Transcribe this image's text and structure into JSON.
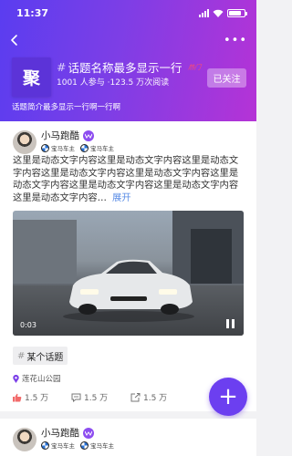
{
  "status_bar": {
    "time": "11:37"
  },
  "topic": {
    "logo_char": "聚",
    "hash": "#",
    "title": "话题名称最多显示一行",
    "hot_label": "热门",
    "stats": "1001 人参与 ·123.5 万次阅读",
    "follow_label": "已关注",
    "description": "话题简介最多显示一行啊一行啊"
  },
  "post": {
    "username": "小马跑酷",
    "badges": [
      "宝马车主",
      "宝马车主"
    ],
    "content": "这里是动态文字内容这里是动态文字内容这里是动态文字内容这里是动态文字内容这里是动态文字内容这里是动态文字内容这里是动态文字内容这里是动态文字内容这里是动态文字内容…",
    "expand_label": "展开",
    "video_time": "0:03",
    "tag_hash": "#",
    "tag": "某个话题",
    "location": "莲花山公园",
    "likes": "1.5 万",
    "comments": "1.5 万",
    "shares": "1.5 万"
  },
  "post2": {
    "username": "小马跑酷",
    "badges": [
      "宝马车主",
      "宝马车主"
    ]
  },
  "icons": {
    "back": "back-icon",
    "more": "more-icon",
    "like": "thumb-up-icon",
    "comment": "comment-icon",
    "share": "share-icon",
    "location": "location-pin-icon",
    "add": "plus-icon"
  },
  "colors": {
    "accent": "#6c3ff0",
    "header_start": "#5a3df0",
    "header_end": "#b533d6",
    "link": "#5b8de6"
  }
}
